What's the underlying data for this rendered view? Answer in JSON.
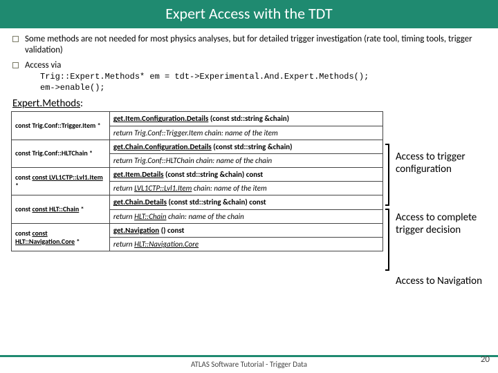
{
  "title": "Expert Access with the TDT",
  "bullets": [
    "Some methods are not needed for most physics analyses, but for detailed trigger investigation (rate tool, timing tools, trigger validation)",
    "Access via"
  ],
  "code": {
    "l1": "Trig::Expert.Methods* em = tdt->Experimental.And.Expert.Methods();",
    "l2": "em->enable();"
  },
  "section": "Expert.Methods",
  "rows": [
    {
      "ret": "const Trig.Conf::Trigger.Item *",
      "sig_u": "get.Item.Configuration.Details",
      "sig_r": " (const std::string &chain)",
      "desc": "return Trig.Conf::Trigger.Item chain: name of the item"
    },
    {
      "ret": "const Trig.Conf::HLTChain *",
      "sig_u": "get.Chain.Configuration.Details",
      "sig_r": " (const std::string &chain)",
      "desc": "return Trig.Conf::HLTChain chain: name of the chain"
    },
    {
      "ret": "const LVL1CTP::Lvl1.Item",
      "ret_r": " *",
      "sig_u": "get.Item.Details",
      "sig_r": " (const std::string &chain) const",
      "desc_pre": "return ",
      "desc_u": "LVL1CTP::Lvl1.Item",
      "desc_post": " chain: name of the item"
    },
    {
      "ret": "const HLT::Chain",
      "ret_r": " *",
      "sig_u": "get.Chain.Details",
      "sig_r": " (const std::string &chain) const",
      "desc_pre": "return ",
      "desc_u": "HLT::Chain",
      "desc_post": " chain: name of the chain"
    },
    {
      "ret": "const HLT::Navigation.Core",
      "ret_r": " *",
      "sig_u": "get.Navigation",
      "sig_r": " () const",
      "desc_pre": "return ",
      "desc_u": "HLT::Navigation.Core",
      "desc_post": ""
    }
  ],
  "groups": {
    "g1": "Access to trigger configuration",
    "g2": "Access to complete trigger decision",
    "g3": "Access to Navigation"
  },
  "footer": "ATLAS Software Tutorial - Trigger Data",
  "page": "20"
}
